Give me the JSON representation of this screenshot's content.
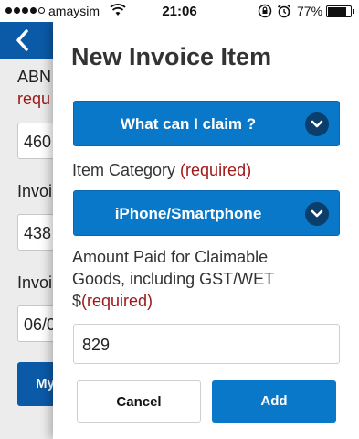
{
  "status_bar": {
    "carrier": "amaysim",
    "time": "21:06",
    "battery": "77%",
    "battery_level": 0.77,
    "icons": [
      "signal-dots-icon",
      "wifi-icon",
      "rotation-lock-icon",
      "alarm-icon",
      "battery-icon"
    ]
  },
  "background_page": {
    "abn_label": "ABN",
    "abn_required": "requ",
    "abn_value": "460",
    "invoice_label_1": "Invoi",
    "invoice_value_1": "438",
    "invoice_label_2": "Invoi",
    "invoice_value_2": "06/0",
    "button_label": "My"
  },
  "modal": {
    "title": "New Invoice Item",
    "claim_select": {
      "label": "What can I claim ?"
    },
    "category": {
      "label": "Item Category ",
      "required": "(required)",
      "selected": "iPhone/Smartphone"
    },
    "amount": {
      "label_line1": "Amount Paid for Claimable",
      "label_line2": "Goods, including GST/WET",
      "label_prefix": "$",
      "required": "(required)",
      "value": "829"
    },
    "cancel_label": "Cancel",
    "add_label": "Add"
  },
  "colors": {
    "primary": "#0a78c8",
    "header": "#0b5aa8",
    "required": "#a01818",
    "chevron_circle": "#0b3e6a"
  }
}
